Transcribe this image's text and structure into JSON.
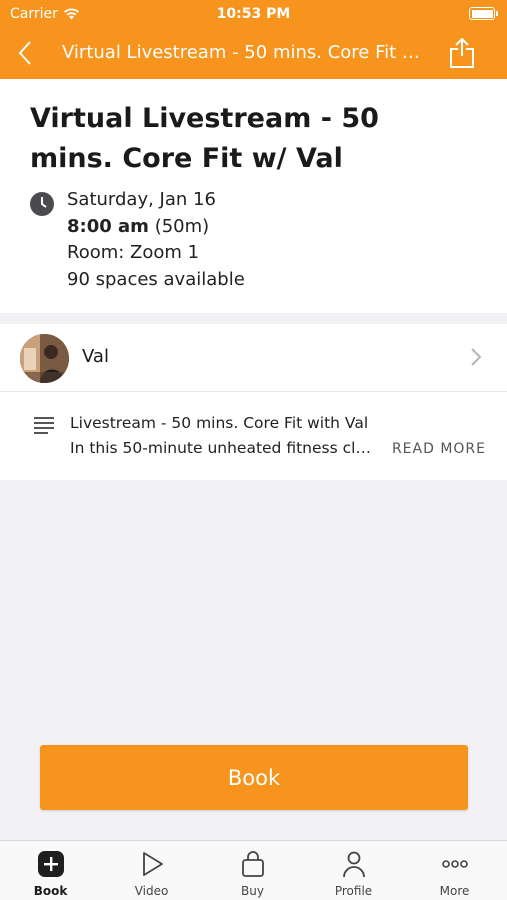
{
  "status_bar": {
    "carrier": "Carrier",
    "time": "10:53 PM"
  },
  "nav": {
    "title": "Virtual Livestream - 50 mins. Core Fit w/ Val"
  },
  "class": {
    "title": "Virtual Livestream - 50 mins. Core Fit w/ Val",
    "date": "Saturday, Jan 16",
    "time": "8:00 am",
    "duration": "(50m)",
    "room": "Room: Zoom 1",
    "spaces": "90 spaces available"
  },
  "instructor": {
    "name": "Val"
  },
  "description": {
    "title": "Livestream - 50 mins. Core Fit with Val",
    "body": "In this 50-minute unheated fitness class",
    "read_more": "READ MORE"
  },
  "book_button": {
    "label": "Book"
  },
  "tabs": [
    {
      "label": "Book",
      "icon": "plus-square-icon",
      "active": true
    },
    {
      "label": "Video",
      "icon": "play-icon",
      "active": false
    },
    {
      "label": "Buy",
      "icon": "shopping-bag-icon",
      "active": false
    },
    {
      "label": "Profile",
      "icon": "person-icon",
      "active": false
    },
    {
      "label": "More",
      "icon": "more-dots-icon",
      "active": false
    }
  ],
  "colors": {
    "accent": "#f7941d",
    "background": "#f2f2f4"
  }
}
